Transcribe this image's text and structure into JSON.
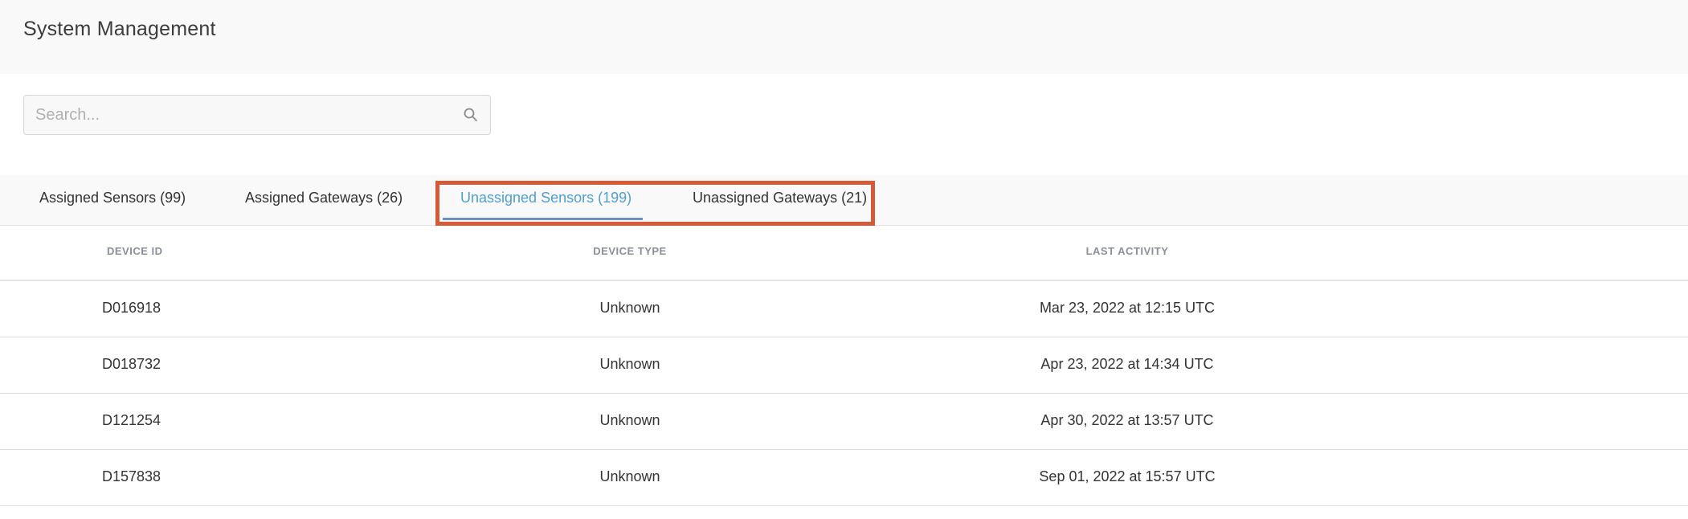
{
  "header": {
    "title": "System Management"
  },
  "search": {
    "placeholder": "Search..."
  },
  "tabs": [
    {
      "label": "Assigned Sensors (99)",
      "active": false
    },
    {
      "label": "Assigned Gateways (26)",
      "active": false
    },
    {
      "label": "Unassigned Sensors (199)",
      "active": true
    },
    {
      "label": "Unassigned Gateways (21)",
      "active": false
    }
  ],
  "table": {
    "columns": [
      "DEVICE ID",
      "DEVICE TYPE",
      "LAST ACTIVITY"
    ],
    "rows": [
      {
        "device_id": "D016918",
        "device_type": "Unknown",
        "last_activity": "Mar 23, 2022 at 12:15 UTC"
      },
      {
        "device_id": "D018732",
        "device_type": "Unknown",
        "last_activity": "Apr 23, 2022 at 14:34 UTC"
      },
      {
        "device_id": "D121254",
        "device_type": "Unknown",
        "last_activity": "Apr 30, 2022 at 13:57 UTC"
      },
      {
        "device_id": "D157838",
        "device_type": "Unknown",
        "last_activity": "Sep 01, 2022 at 15:57 UTC"
      }
    ]
  },
  "icons": {
    "search": "search-icon"
  },
  "colors": {
    "active_tab": "#4f9fd1",
    "tab_underline": "#6b8fc4",
    "highlight_border": "#d45a38",
    "header_bg": "#f9f9f9"
  }
}
